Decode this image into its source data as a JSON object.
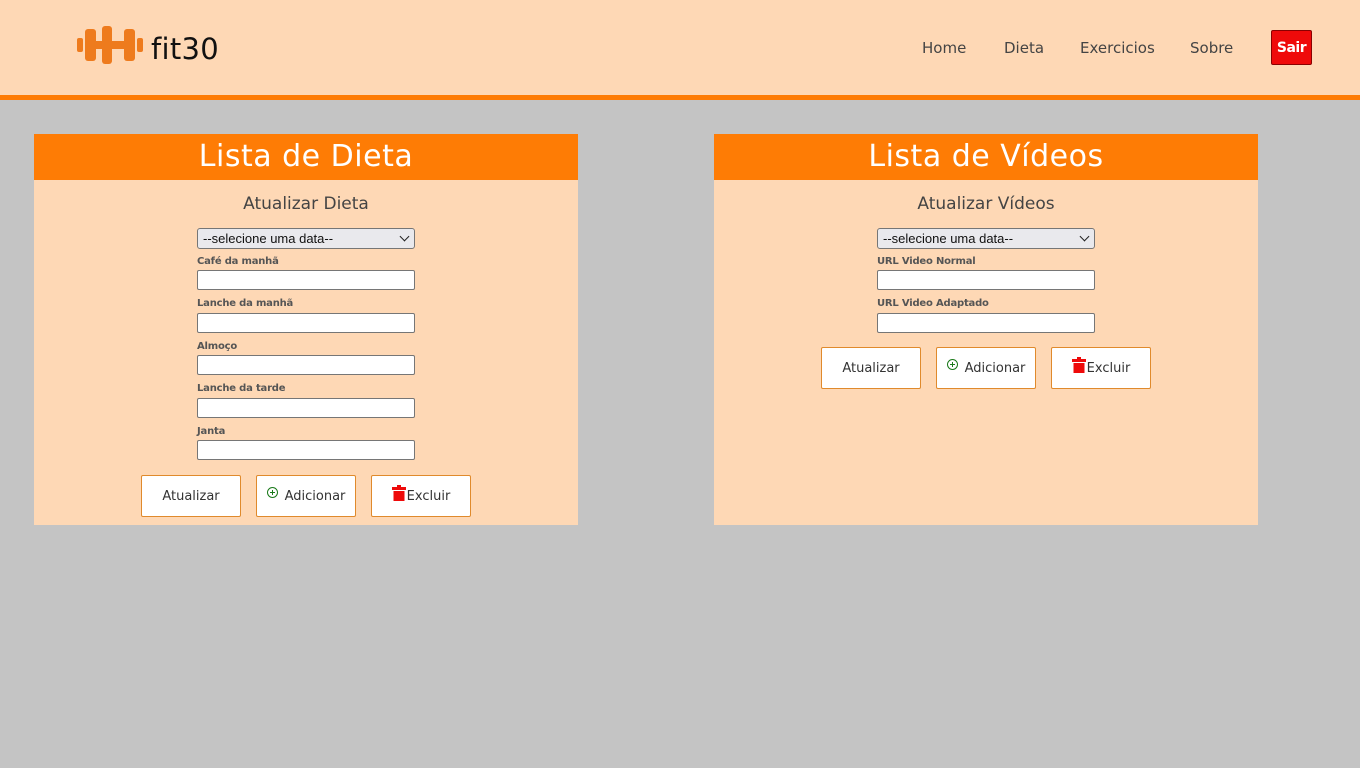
{
  "app": {
    "logo_text": "fit30"
  },
  "nav": {
    "home": "Home",
    "dieta": "Dieta",
    "exercicios": "Exercicios",
    "sobre": "Sobre",
    "sair": "Sair"
  },
  "colors": {
    "accent": "#fe7c05",
    "panel_bg": "#fed8b5",
    "page_bg": "#c4c4c4",
    "danger": "#ef0a0a"
  },
  "diet_panel": {
    "title": "Lista de Dieta",
    "subtitle": "Atualizar Dieta",
    "select_value": "--selecione uma data--",
    "fields": [
      {
        "label": "Café da manhã",
        "value": ""
      },
      {
        "label": "Lanche da manhã",
        "value": ""
      },
      {
        "label": "Almoço",
        "value": ""
      },
      {
        "label": "Lanche da tarde",
        "value": ""
      },
      {
        "label": "Janta",
        "value": ""
      }
    ],
    "buttons": {
      "update": "Atualizar",
      "add": "Adicionar",
      "delete": "Excluir"
    }
  },
  "video_panel": {
    "title": "Lista de Vídeos",
    "subtitle": "Atualizar Vídeos",
    "select_value": "--selecione uma data--",
    "fields": [
      {
        "label": "URL Video Normal",
        "value": ""
      },
      {
        "label": "URL Video Adaptado",
        "value": ""
      }
    ],
    "buttons": {
      "update": "Atualizar",
      "add": "Adicionar",
      "delete": "Excluir"
    }
  }
}
